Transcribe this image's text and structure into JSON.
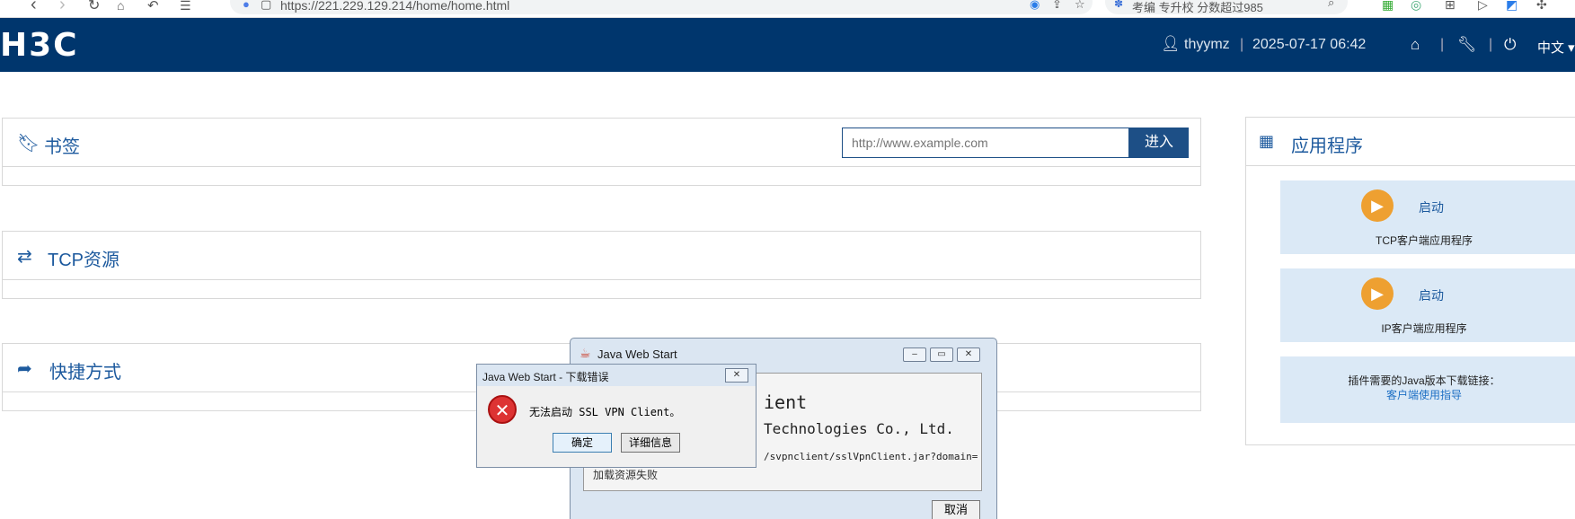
{
  "browser": {
    "url": "https://221.229.129.214/home/home.html",
    "search_text": "考编 专升校 分数超过985"
  },
  "header": {
    "logo": "H3C",
    "username": "thyymz",
    "separator": "|",
    "datetime": "2025-07-17 06:42",
    "language": "中文"
  },
  "bookmarks": {
    "title": "书签",
    "url_placeholder": "http://www.example.com",
    "enter_label": "进入"
  },
  "tcp": {
    "title": "TCP资源"
  },
  "shortcuts": {
    "title": "快捷方式"
  },
  "apps": {
    "title": "应用程序",
    "items": [
      {
        "launch_label": "启动",
        "name": "TCP客户端应用程序"
      },
      {
        "launch_label": "启动",
        "name": "IP客户端应用程序"
      }
    ],
    "java_note": "插件需要的Java版本下载链接：",
    "java_link": "客户端使用指导"
  },
  "jws_window": {
    "title": "Java Web Start",
    "line1": "ient",
    "line2": "Technologies Co., Ltd.",
    "line3": "/svpnclient/sslVpnClient.jar?domain=",
    "line4": "加载资源失败",
    "cancel_label": "取消"
  },
  "error_dialog": {
    "title": "Java Web Start - 下载错误",
    "message": "无法启动 SSL VPN Client。",
    "ok_label": "确定",
    "details_label": "详细信息"
  },
  "colors": {
    "header_bg": "#00366d",
    "accent": "#1d5a9e",
    "launch": "#eea031",
    "card_bg": "#dbe9f6"
  }
}
